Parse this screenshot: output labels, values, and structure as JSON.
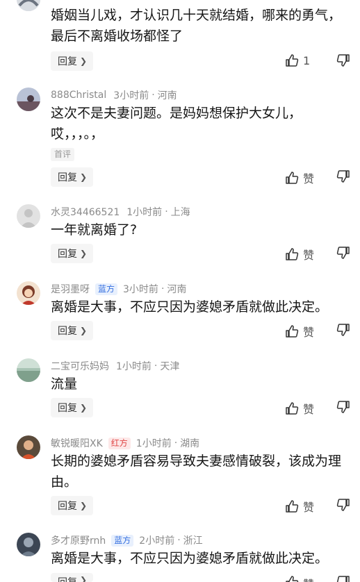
{
  "reply_label": "回复",
  "first_tag": "首评",
  "comments": [
    {
      "user": "",
      "time": "",
      "location": "",
      "text": "婚姻当儿戏，才认识几十天就结婚，哪来的勇气，最后不离婚收场都怪了",
      "likes": "1"
    },
    {
      "user": "888Christal",
      "time": "3小时前",
      "location": "河南",
      "text": "这次不是夫妻问题。是妈妈想保护大女儿，哎，，，。，",
      "likes": "赞"
    },
    {
      "user": "水灵34466521",
      "time": "1小时前",
      "location": "上海",
      "text": "一年就离婚了?",
      "likes": "赞"
    },
    {
      "user": "是羽墨呀",
      "badge": "蓝方",
      "time": "3小时前",
      "location": "河南",
      "text": "离婚是大事，不应只因为婆媳矛盾就做此决定。",
      "likes": "赞"
    },
    {
      "user": "二宝可乐妈妈",
      "time": "1小时前",
      "location": "天津",
      "text": "流量",
      "likes": "赞"
    },
    {
      "user": "敏锐暖阳XK",
      "badge": "红方",
      "time": "1小时前",
      "location": "湖南",
      "text": "长期的婆媳矛盾容易导致夫妻感情破裂，该成为理由。",
      "likes": "赞"
    },
    {
      "user": "多才原野rnh",
      "badge": "蓝方",
      "time": "2小时前",
      "location": "浙江",
      "text": "离婚是大事，不应只因为婆媳矛盾就做此决定。",
      "likes": "赞"
    }
  ],
  "colors": {
    "badge_blue": "#3670e0",
    "badge_red": "#e04444",
    "meta": "#8a8a8a"
  }
}
